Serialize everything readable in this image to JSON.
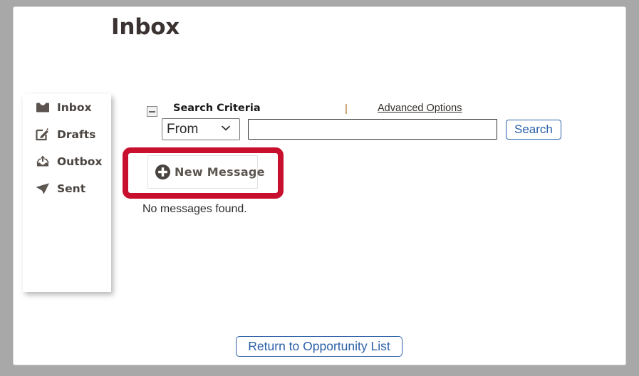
{
  "page": {
    "title": "Inbox"
  },
  "sidebar": {
    "items": [
      {
        "label": "Inbox",
        "icon": "inbox-tray-icon"
      },
      {
        "label": "Drafts",
        "icon": "pencil-square-icon"
      },
      {
        "label": "Outbox",
        "icon": "outbox-upload-icon"
      },
      {
        "label": "Sent",
        "icon": "paper-plane-icon"
      }
    ]
  },
  "search": {
    "collapse_icon": "minus-square-icon",
    "criteria_label": "Search Criteria",
    "separator": "|",
    "advanced_options_label": "Advanced Options",
    "field_selected": "From",
    "field_options": [
      "From"
    ],
    "dropdown_icon": "chevron-down-icon",
    "query_value": "",
    "query_placeholder": "",
    "search_button_label": "Search"
  },
  "messages": {
    "new_message_label": "New Message",
    "new_message_icon": "plus-circle-icon",
    "empty_text": "No messages found."
  },
  "footer": {
    "return_button_label": "Return to Opportunity List"
  },
  "colors": {
    "highlight": "#c8102e",
    "link_blue": "#2a5fa8",
    "frame_gray": "#a8a8a8",
    "separator_orange": "#b06a18"
  }
}
